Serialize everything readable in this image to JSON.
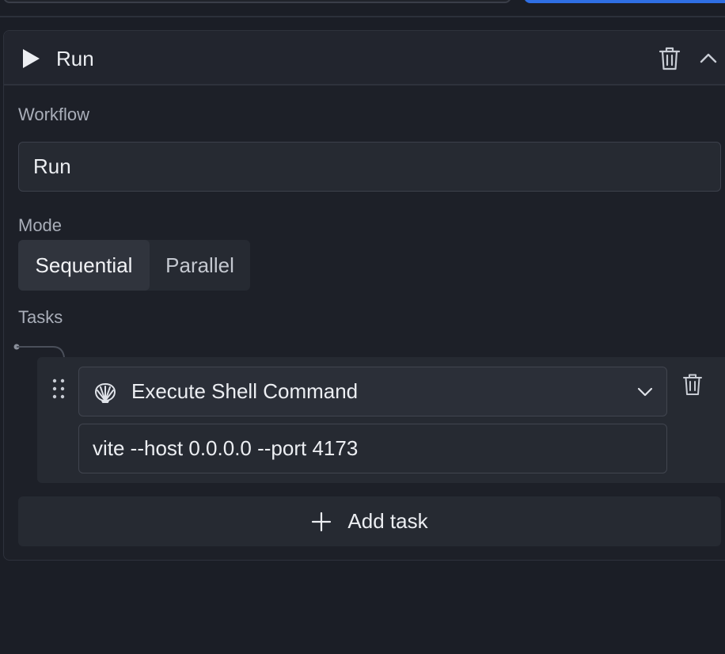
{
  "workflow_card": {
    "title": "Run",
    "workflow_label": "Workflow",
    "workflow_value": "Run",
    "mode_label": "Mode",
    "modes": [
      "Sequential",
      "Parallel"
    ],
    "selected_mode": "Sequential",
    "tasks_label": "Tasks"
  },
  "tasks": [
    {
      "type": "Execute Shell Command",
      "command": "vite --host 0.0.0.0 --port 4173"
    }
  ],
  "add_task_label": "Add task",
  "icons": {
    "run": "play-icon",
    "delete": "trash-icon",
    "collapse": "chevron-up-icon",
    "drag": "drag-handle-icon",
    "shell": "shell-icon",
    "dropdown": "chevron-down-icon",
    "add": "plus-icon"
  },
  "colors": {
    "background": "#1b1e26",
    "accent": "#2f6fe4"
  }
}
